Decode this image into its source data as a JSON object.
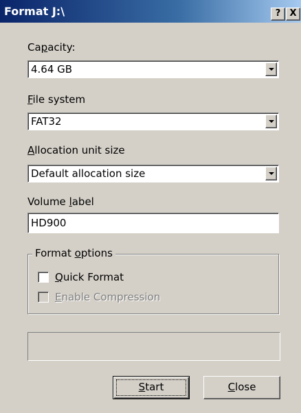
{
  "window": {
    "title": "Format J:\\",
    "help_btn": "?",
    "close_btn": "X"
  },
  "capacity": {
    "label": "Capacity:",
    "value": "4.64 GB"
  },
  "file_system": {
    "label": "File system",
    "value": "FAT32"
  },
  "allocation": {
    "label": "Allocation unit size",
    "value": "Default allocation size"
  },
  "volume": {
    "label": "Volume label",
    "value": "HD900"
  },
  "options": {
    "title": "Format options",
    "quick_format": {
      "label": "Quick Format",
      "checked": false
    },
    "compression": {
      "label": "Enable Compression",
      "checked": false,
      "enabled": false
    }
  },
  "progress": {
    "value": 0
  },
  "buttons": {
    "start": "Start",
    "close": "Close"
  },
  "icons": {
    "dropdown": "chevron-down-icon"
  }
}
